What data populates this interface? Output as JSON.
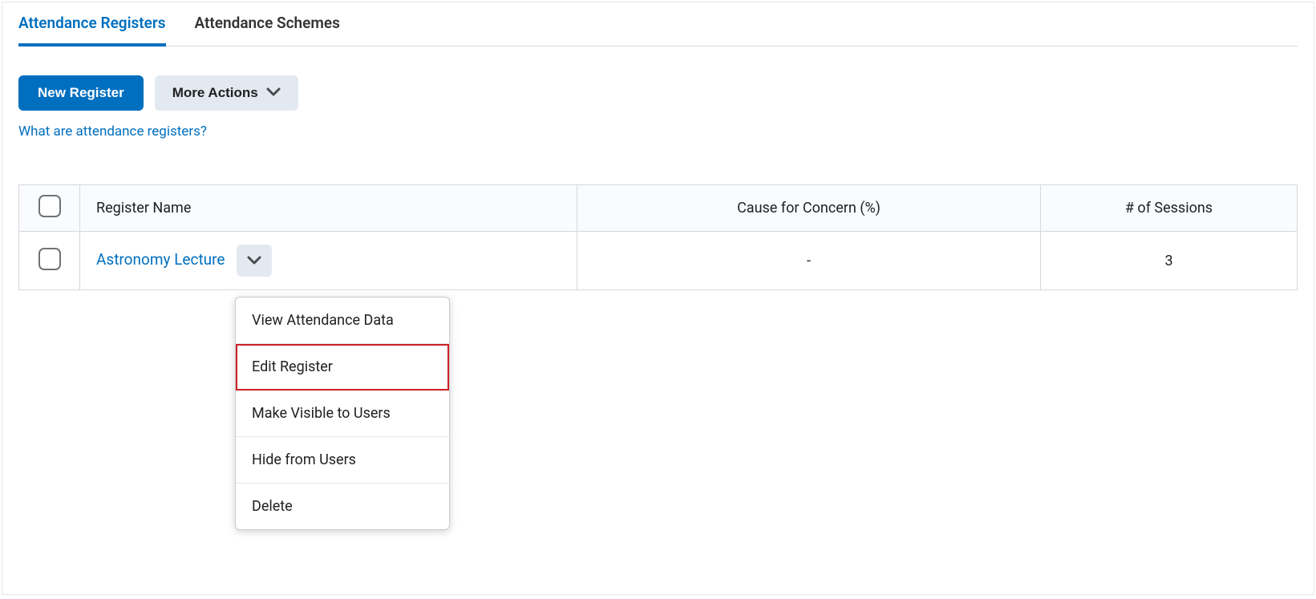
{
  "tabs": {
    "registers": "Attendance Registers",
    "schemes": "Attendance Schemes"
  },
  "toolbar": {
    "new_register": "New Register",
    "more_actions": "More Actions"
  },
  "help_link": "What are attendance registers?",
  "table": {
    "headers": {
      "name": "Register Name",
      "concern": "Cause for Concern (%)",
      "sessions": "# of Sessions"
    },
    "rows": [
      {
        "name": "Astronomy Lecture",
        "concern": "-",
        "sessions": "3"
      }
    ]
  },
  "dropdown": {
    "items": [
      "View Attendance Data",
      "Edit Register",
      "Make Visible to Users",
      "Hide from Users",
      "Delete"
    ],
    "highlight_index": 1
  }
}
